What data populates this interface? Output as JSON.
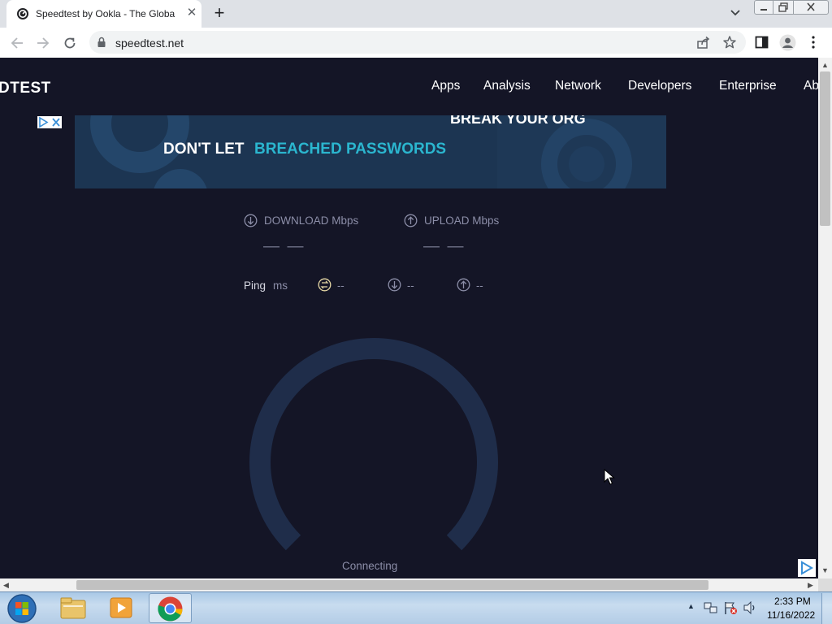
{
  "browser": {
    "tab_title": "Speedtest by Ookla - The Global",
    "tab_close": "✕",
    "new_tab": "+",
    "url": "speedtest.net"
  },
  "site": {
    "logo": "DTEST",
    "nav": [
      "Apps",
      "Analysis",
      "Network",
      "Developers",
      "Enterprise",
      "Ab"
    ]
  },
  "ad": {
    "line_white": "DON'T LET",
    "line_accent": "BREACHED PASSWORDS",
    "line_top": "BREAK YOUR ORG"
  },
  "speedtest": {
    "download_label": "DOWNLOAD Mbps",
    "download_value": "— —",
    "upload_label": "UPLOAD Mbps",
    "upload_value": "— —",
    "ping_label": "Ping",
    "ping_unit": "ms",
    "ping_value": "--",
    "ping_down_value": "--",
    "ping_up_value": "--",
    "status": "Connecting"
  },
  "taskbar": {
    "time": "2:33 PM",
    "date": "11/16/2022"
  },
  "colors": {
    "page_bg": "#141526",
    "gauge": "#1f2d4a",
    "ad_bg": "#1c3552",
    "ad_accent": "#2bb6cf"
  }
}
